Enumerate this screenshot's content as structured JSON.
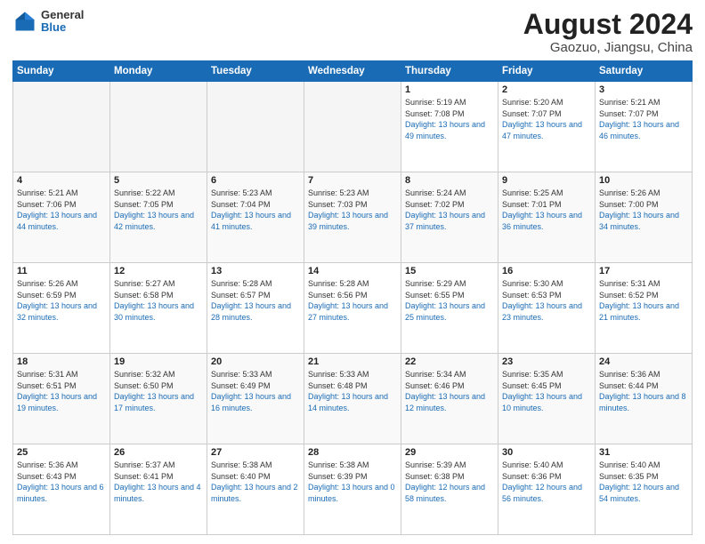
{
  "header": {
    "logo_general": "General",
    "logo_blue": "Blue",
    "title": "August 2024",
    "subtitle": "Gaozuo, Jiangsu, China"
  },
  "weekdays": [
    "Sunday",
    "Monday",
    "Tuesday",
    "Wednesday",
    "Thursday",
    "Friday",
    "Saturday"
  ],
  "weeks": [
    [
      {
        "day": "",
        "empty": true
      },
      {
        "day": "",
        "empty": true
      },
      {
        "day": "",
        "empty": true
      },
      {
        "day": "",
        "empty": true
      },
      {
        "day": "1",
        "sunrise": "5:19 AM",
        "sunset": "7:08 PM",
        "daylight": "13 hours and 49 minutes."
      },
      {
        "day": "2",
        "sunrise": "5:20 AM",
        "sunset": "7:07 PM",
        "daylight": "13 hours and 47 minutes."
      },
      {
        "day": "3",
        "sunrise": "5:21 AM",
        "sunset": "7:07 PM",
        "daylight": "13 hours and 46 minutes."
      }
    ],
    [
      {
        "day": "4",
        "sunrise": "5:21 AM",
        "sunset": "7:06 PM",
        "daylight": "13 hours and 44 minutes."
      },
      {
        "day": "5",
        "sunrise": "5:22 AM",
        "sunset": "7:05 PM",
        "daylight": "13 hours and 42 minutes."
      },
      {
        "day": "6",
        "sunrise": "5:23 AM",
        "sunset": "7:04 PM",
        "daylight": "13 hours and 41 minutes."
      },
      {
        "day": "7",
        "sunrise": "5:23 AM",
        "sunset": "7:03 PM",
        "daylight": "13 hours and 39 minutes."
      },
      {
        "day": "8",
        "sunrise": "5:24 AM",
        "sunset": "7:02 PM",
        "daylight": "13 hours and 37 minutes."
      },
      {
        "day": "9",
        "sunrise": "5:25 AM",
        "sunset": "7:01 PM",
        "daylight": "13 hours and 36 minutes."
      },
      {
        "day": "10",
        "sunrise": "5:26 AM",
        "sunset": "7:00 PM",
        "daylight": "13 hours and 34 minutes."
      }
    ],
    [
      {
        "day": "11",
        "sunrise": "5:26 AM",
        "sunset": "6:59 PM",
        "daylight": "13 hours and 32 minutes."
      },
      {
        "day": "12",
        "sunrise": "5:27 AM",
        "sunset": "6:58 PM",
        "daylight": "13 hours and 30 minutes."
      },
      {
        "day": "13",
        "sunrise": "5:28 AM",
        "sunset": "6:57 PM",
        "daylight": "13 hours and 28 minutes."
      },
      {
        "day": "14",
        "sunrise": "5:28 AM",
        "sunset": "6:56 PM",
        "daylight": "13 hours and 27 minutes."
      },
      {
        "day": "15",
        "sunrise": "5:29 AM",
        "sunset": "6:55 PM",
        "daylight": "13 hours and 25 minutes."
      },
      {
        "day": "16",
        "sunrise": "5:30 AM",
        "sunset": "6:53 PM",
        "daylight": "13 hours and 23 minutes."
      },
      {
        "day": "17",
        "sunrise": "5:31 AM",
        "sunset": "6:52 PM",
        "daylight": "13 hours and 21 minutes."
      }
    ],
    [
      {
        "day": "18",
        "sunrise": "5:31 AM",
        "sunset": "6:51 PM",
        "daylight": "13 hours and 19 minutes."
      },
      {
        "day": "19",
        "sunrise": "5:32 AM",
        "sunset": "6:50 PM",
        "daylight": "13 hours and 17 minutes."
      },
      {
        "day": "20",
        "sunrise": "5:33 AM",
        "sunset": "6:49 PM",
        "daylight": "13 hours and 16 minutes."
      },
      {
        "day": "21",
        "sunrise": "5:33 AM",
        "sunset": "6:48 PM",
        "daylight": "13 hours and 14 minutes."
      },
      {
        "day": "22",
        "sunrise": "5:34 AM",
        "sunset": "6:46 PM",
        "daylight": "13 hours and 12 minutes."
      },
      {
        "day": "23",
        "sunrise": "5:35 AM",
        "sunset": "6:45 PM",
        "daylight": "13 hours and 10 minutes."
      },
      {
        "day": "24",
        "sunrise": "5:36 AM",
        "sunset": "6:44 PM",
        "daylight": "13 hours and 8 minutes."
      }
    ],
    [
      {
        "day": "25",
        "sunrise": "5:36 AM",
        "sunset": "6:43 PM",
        "daylight": "13 hours and 6 minutes."
      },
      {
        "day": "26",
        "sunrise": "5:37 AM",
        "sunset": "6:41 PM",
        "daylight": "13 hours and 4 minutes."
      },
      {
        "day": "27",
        "sunrise": "5:38 AM",
        "sunset": "6:40 PM",
        "daylight": "13 hours and 2 minutes."
      },
      {
        "day": "28",
        "sunrise": "5:38 AM",
        "sunset": "6:39 PM",
        "daylight": "13 hours and 0 minutes."
      },
      {
        "day": "29",
        "sunrise": "5:39 AM",
        "sunset": "6:38 PM",
        "daylight": "12 hours and 58 minutes."
      },
      {
        "day": "30",
        "sunrise": "5:40 AM",
        "sunset": "6:36 PM",
        "daylight": "12 hours and 56 minutes."
      },
      {
        "day": "31",
        "sunrise": "5:40 AM",
        "sunset": "6:35 PM",
        "daylight": "12 hours and 54 minutes."
      }
    ]
  ]
}
